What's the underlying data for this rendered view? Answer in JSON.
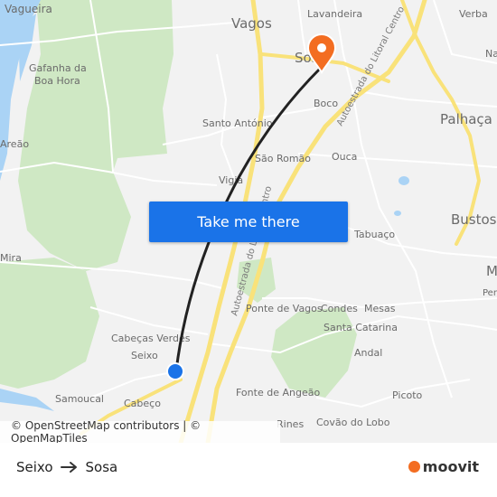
{
  "map": {
    "places": [
      {
        "key": "vagueira",
        "label": "Vagueira"
      },
      {
        "key": "gafanha",
        "label": "Gafanha da"
      },
      {
        "key": "boa_hora",
        "label": "Boa Hora"
      },
      {
        "key": "areao",
        "label": "Areão"
      },
      {
        "key": "mira",
        "label": "Mira"
      },
      {
        "key": "vagos",
        "label": "Vagos"
      },
      {
        "key": "lavandeira",
        "label": "Lavandeira"
      },
      {
        "key": "sosa_map",
        "label": "Sosa"
      },
      {
        "key": "verba",
        "label": "Verba"
      },
      {
        "key": "na",
        "label": "Na"
      },
      {
        "key": "palhaca",
        "label": "Palhaça"
      },
      {
        "key": "boco",
        "label": "Boco"
      },
      {
        "key": "santo_antonio",
        "label": "Santo António"
      },
      {
        "key": "sao_romao",
        "label": "São Romão"
      },
      {
        "key": "ouca",
        "label": "Ouca"
      },
      {
        "key": "vigia",
        "label": "Vigia"
      },
      {
        "key": "bustos",
        "label": "Bustos"
      },
      {
        "key": "tabuaco",
        "label": "Tabuaço"
      },
      {
        "key": "m",
        "label": "M"
      },
      {
        "key": "per",
        "label": "Per"
      },
      {
        "key": "ponte_vagos",
        "label": "Ponte de Vagos"
      },
      {
        "key": "condes",
        "label": "Condes"
      },
      {
        "key": "mesas",
        "label": "Mesas"
      },
      {
        "key": "santa_catarina",
        "label": "Santa Catarina"
      },
      {
        "key": "cabecas_verdes",
        "label": "Cabeças Verdes"
      },
      {
        "key": "seixo_map",
        "label": "Seixo"
      },
      {
        "key": "andal",
        "label": "Andal"
      },
      {
        "key": "samoucal",
        "label": "Samoucal"
      },
      {
        "key": "cabeco",
        "label": "Cabeço"
      },
      {
        "key": "fonte_angeao",
        "label": "Fonte de Angeão"
      },
      {
        "key": "picoto",
        "label": "Picoto"
      },
      {
        "key": "rines",
        "label": "Rines"
      },
      {
        "key": "covao_lobo",
        "label": "Covão do Lobo"
      }
    ],
    "roads": [
      {
        "key": "a17_top",
        "label": "Autoestrada do Litoral Centro"
      },
      {
        "key": "a17_bottom",
        "label": "Autoestrada do Litoral Centro"
      }
    ],
    "colors": {
      "water": "#aad3f5",
      "forest": "#cfe8c4",
      "land": "#f2f2f2",
      "major_road": "#f9e27a",
      "route_line": "#222222",
      "origin_marker": "#1a73e8",
      "destination_marker": "#f36d21"
    }
  },
  "cta": {
    "label": "Take me there"
  },
  "attribution": "© OpenStreetMap contributors | © OpenMapTiles",
  "route": {
    "origin": "Seixo",
    "destination": "Sosa"
  },
  "brand": {
    "name": "moovit"
  }
}
